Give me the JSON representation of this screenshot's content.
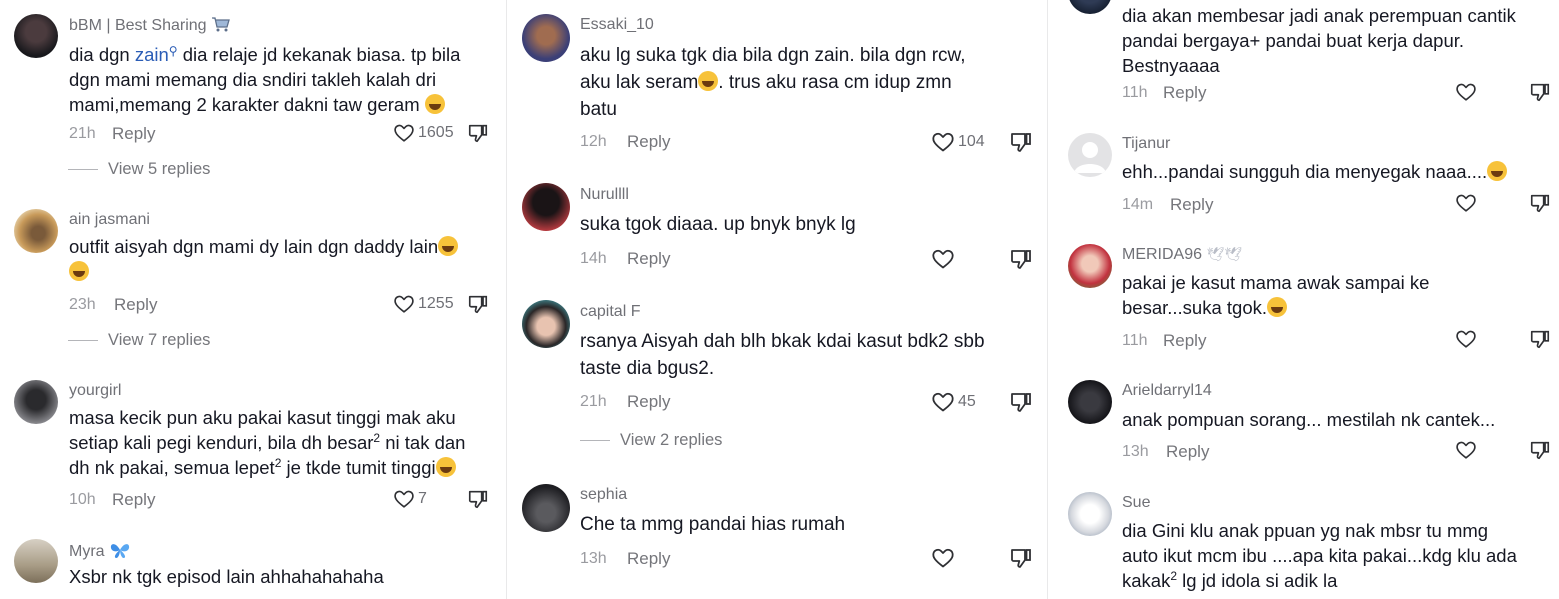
{
  "colors": {
    "text": "#161823",
    "muted": "#75767b",
    "mention": "#2b5db6"
  },
  "panel1": {
    "c1": {
      "username": "bBM | Best Sharing",
      "mention": "zain",
      "line1_pre": "dia dgn ",
      "line1_post": " dia relaje jd kekanak biasa. tp bila",
      "line2": "dgn mami memang dia sndiri takleh kalah dri",
      "line3": "mami,memang 2 karakter dakni taw geram",
      "time": "21h",
      "reply": "Reply",
      "likes": "1605",
      "view": "View 5 replies"
    },
    "c2": {
      "username": "ain jasmani",
      "line1": "outfit aisyah dgn mami dy lain dgn daddy lain",
      "time": "23h",
      "reply": "Reply",
      "likes": "1255",
      "view": "View 7 replies"
    },
    "c3": {
      "username": "yourgirl",
      "line1": "masa kecik pun aku pakai kasut tinggi mak aku",
      "line2_pre": "setiap kali pegi kenduri, bila dh besar",
      "line2_post": " ni tak dan",
      "line3_pre": "dh nk pakai, semua lepet",
      "line3_post": " je tkde tumit tinggi",
      "sup": "2",
      "time": "10h",
      "reply": "Reply",
      "likes": "7"
    },
    "c4": {
      "username": "Myra",
      "line1": "Xsbr nk tgk episod lain ahhahahahaha"
    }
  },
  "panel2": {
    "c1": {
      "username": "Essaki_10",
      "line1": "aku lg suka tgk dia bila dgn zain. bila dgn rcw,",
      "line2_pre": "aku lak seram",
      "line2_post": ". trus aku rasa cm idup zmn",
      "line3": "batu",
      "time": "12h",
      "reply": "Reply",
      "likes": "104"
    },
    "c2": {
      "username": "Nurullll",
      "line1": "suka tgok diaaa. up bnyk bnyk lg",
      "time": "14h",
      "reply": "Reply"
    },
    "c3": {
      "username": "capital F",
      "line1": "rsanya Aisyah dah blh bkak kdai kasut bdk2 sbb",
      "line2": "taste dia bgus2.",
      "time": "21h",
      "reply": "Reply",
      "likes": "45",
      "view": "View 2 replies"
    },
    "c4": {
      "username": "sephia",
      "line1": "Che ta mmg pandai hias rumah",
      "time": "13h",
      "reply": "Reply"
    }
  },
  "panel3": {
    "c1": {
      "line1": "dia akan membesar jadi anak perempuan cantik",
      "line2": "pandai bergaya+ pandai buat kerja dapur.",
      "line3": "Bestnyaaaa",
      "time": "11h",
      "reply": "Reply"
    },
    "c2": {
      "username": "Tijanur",
      "line1": "ehh...pandai sungguh dia menyegak naaa....",
      "time": "14m",
      "reply": "Reply"
    },
    "c3": {
      "username": "MERIDA96",
      "line1": "pakai je kasut mama awak sampai ke",
      "line2": "besar...suka tgok.",
      "time": "11h",
      "reply": "Reply"
    },
    "c4": {
      "username": "Arieldarryl14",
      "line1": "anak pompuan sorang... mestilah nk cantek...",
      "time": "13h",
      "reply": "Reply"
    },
    "c5": {
      "username": "Sue",
      "line1": "dia Gini klu anak ppuan yg nak mbsr tu mmg",
      "line2": "auto ikut mcm ibu ....apa kita pakai...kdg klu ada",
      "line3_pre": "kakak",
      "line3_post": " lg jd idola si adik la",
      "sup": "2"
    }
  }
}
